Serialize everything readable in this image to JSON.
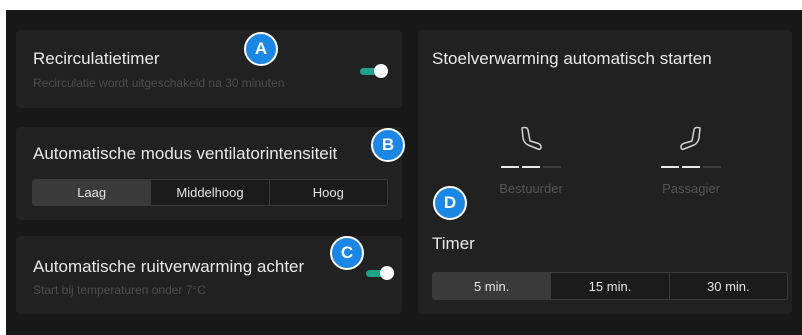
{
  "recirculation": {
    "title": "Recirculatietimer",
    "subtitle": "Recirculatie wordt uitgeschakeld na 30 minuten",
    "enabled": true
  },
  "fan": {
    "title": "Automatische modus ventilatorintensiteit",
    "options": [
      "Laag",
      "Middelhoog",
      "Hoog"
    ],
    "selected": "Laag"
  },
  "rear_defrost": {
    "title": "Automatische ruitverwarming achter",
    "subtitle": "Start bij temperaturen onder 7°C",
    "enabled": true
  },
  "seat_heating": {
    "title": "Stoelverwarming automatisch starten",
    "driver": {
      "label": "Bestuurder",
      "level": 2,
      "max_level": 3,
      "icon": "driver-seat-icon"
    },
    "passenger": {
      "label": "Passagier",
      "level": 2,
      "max_level": 3,
      "icon": "passenger-seat-icon"
    },
    "timer": {
      "title": "Timer",
      "options": [
        "5 min.",
        "15 min.",
        "30 min."
      ],
      "selected": "5 min."
    }
  },
  "badges": [
    "A",
    "B",
    "C",
    "D"
  ],
  "colors": {
    "background": "#181818",
    "card": "#212121",
    "accent": "#1fa38a",
    "badge": "#1a87e6"
  }
}
